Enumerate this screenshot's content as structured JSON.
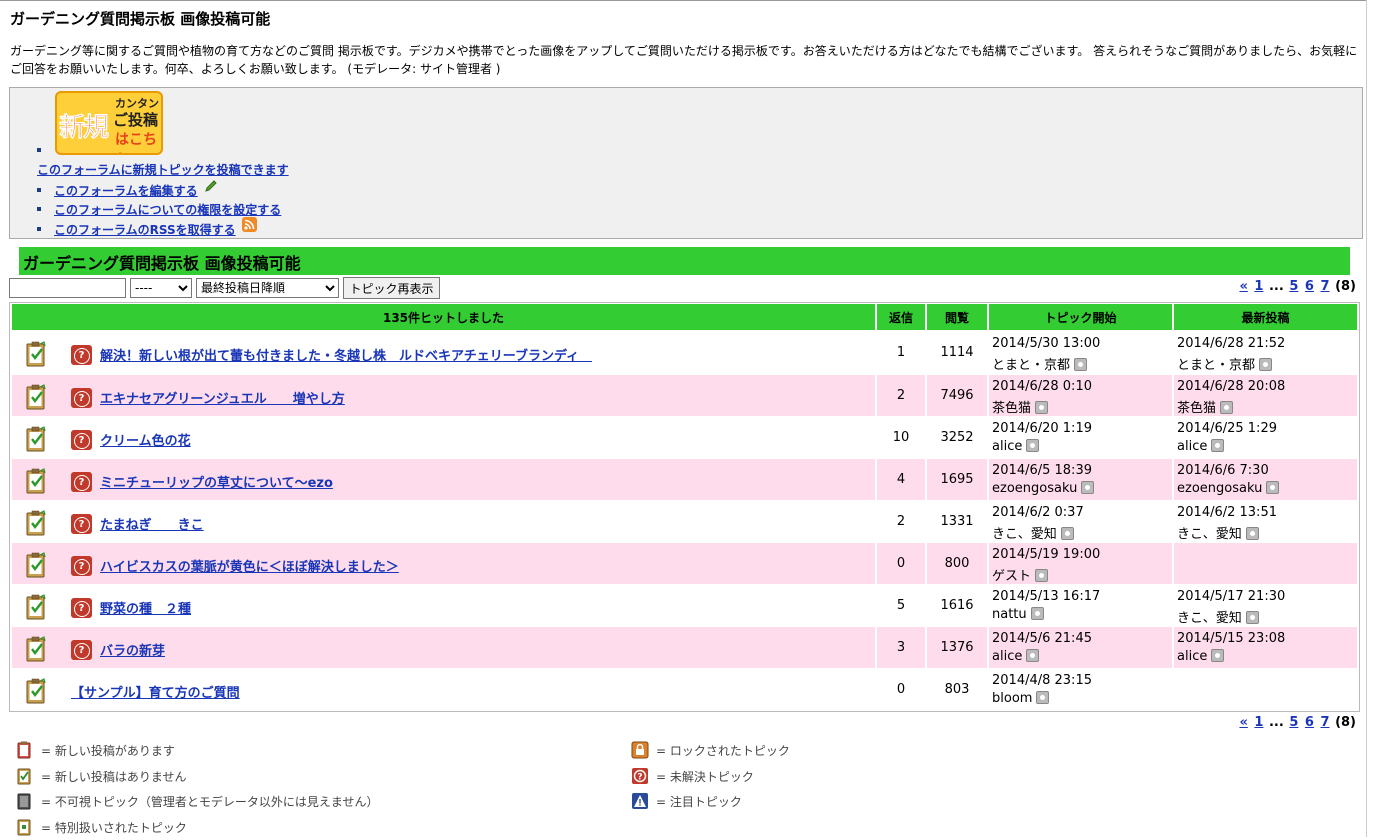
{
  "page": {
    "title": "ガーデニング質問掲示板 画像投稿可能",
    "description": "ガーデニング等に関するご質問や植物の育て方などのご質問 掲示板です。デジカメや携帯でとった画像をアップしてご質問いただける掲示板です。お答えいただける方はどなたでも結構でございます。 答えられそうなご質問がありましたら、お気軽にご回答をお願いいたします。何卒、よろしくお願い致します。 (モデレータ: サイト管理者 )"
  },
  "toolbox": {
    "new_badge": {
      "big": "新規",
      "line1": "カンタン",
      "line2": "ご投稿",
      "line3": "はこちら"
    },
    "new_topic": "このフォーラムに新規トピックを投稿できます",
    "edit_forum": "このフォーラムを編集する",
    "permissions": "このフォーラムについての権限を設定する",
    "rss": "このフォーラムのRSSを取得する"
  },
  "forum_title": "ガーデニング質問掲示板 画像投稿可能",
  "controls": {
    "search_value": "",
    "filter_selected": "----",
    "sort_selected": "最終投稿日降順",
    "refresh_button": "トピック再表示"
  },
  "pager": {
    "prev": "«",
    "first": "1",
    "ellipsis": "...",
    "pages": [
      "5",
      "6",
      "7"
    ],
    "total": "(8)"
  },
  "table": {
    "hit_count": "135件ヒットしました",
    "col_replies": "返信",
    "col_views": "閲覧",
    "col_start": "トピック開始",
    "col_latest": "最新投稿",
    "rows": [
      {
        "title": "解決！新しい根が出て蕾も付きました・冬越し株　ルドベキアチェリーブランディ　",
        "q": true,
        "replies": "1",
        "views": "1114",
        "start_date": "2014/5/30 13:00",
        "start_user": "とまと・京都",
        "last_date": "2014/6/28 21:52",
        "last_user": "とまと・京都"
      },
      {
        "title": "エキナセアグリーンジュエル　　増やし方",
        "q": true,
        "replies": "2",
        "views": "7496",
        "start_date": "2014/6/28 0:10",
        "start_user": "茶色猫",
        "last_date": "2014/6/28 20:08",
        "last_user": "茶色猫"
      },
      {
        "title": "クリーム色の花",
        "q": true,
        "replies": "10",
        "views": "3252",
        "start_date": "2014/6/20 1:19",
        "start_user": "alice",
        "last_date": "2014/6/25 1:29",
        "last_user": "alice"
      },
      {
        "title": "ミニチューリップの草丈について〜ezo",
        "q": true,
        "replies": "4",
        "views": "1695",
        "start_date": "2014/6/5 18:39",
        "start_user": "ezoengosaku",
        "last_date": "2014/6/6 7:30",
        "last_user": "ezoengosaku"
      },
      {
        "title": "たまねぎ　　きこ",
        "q": true,
        "replies": "2",
        "views": "1331",
        "start_date": "2014/6/2 0:37",
        "start_user": "きこ、愛知",
        "last_date": "2014/6/2 13:51",
        "last_user": "きこ、愛知"
      },
      {
        "title": "ハイビスカスの葉脈が黄色に＜ほぼ解決しました＞",
        "q": true,
        "replies": "0",
        "views": "800",
        "start_date": "2014/5/19 19:00",
        "start_user": "ゲスト",
        "last_date": "",
        "last_user": ""
      },
      {
        "title": "野菜の種　２種",
        "q": true,
        "replies": "5",
        "views": "1616",
        "start_date": "2014/5/13 16:17",
        "start_user": "nattu",
        "last_date": "2014/5/17 21:30",
        "last_user": "きこ、愛知"
      },
      {
        "title": "バラの新芽",
        "q": true,
        "replies": "3",
        "views": "1376",
        "start_date": "2014/5/6 21:45",
        "start_user": "alice",
        "last_date": "2014/5/15 23:08",
        "last_user": "alice"
      },
      {
        "title": "【サンプル】育て方のご質問",
        "q": false,
        "replies": "0",
        "views": "803",
        "start_date": "2014/4/8 23:15",
        "start_user": "bloom",
        "last_date": "",
        "last_user": ""
      }
    ]
  },
  "legend": {
    "new_posts": "= 新しい投稿があります",
    "no_new_posts": "= 新しい投稿はありません",
    "invisible": "= 不可視トピック（管理者とモデレータ以外には見えません）",
    "special": "= 特別扱いされたトピック",
    "locked": "= ロックされたトピック",
    "unsolved": "= 未解決トピック",
    "notice": "= 注目トピック"
  },
  "colors": {
    "green": "#33cc33",
    "pink_row": "#ffdceb",
    "link": "#1a36b8",
    "question_red": "#c0392b"
  }
}
